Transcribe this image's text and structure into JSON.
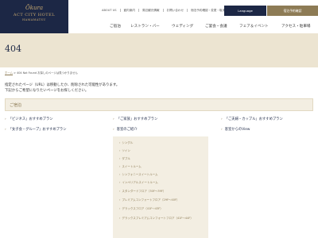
{
  "header": {
    "logo": {
      "mark": "Ōkura",
      "line1": "ACT CITY HOTEL",
      "line2": "HAMAMATSU"
    },
    "utility_links": [
      "ABOUT US",
      "館内案内",
      "周辺観光情報",
      "お問い合わせ",
      "宿泊予約確認・変更・取消"
    ],
    "language_label": "Language",
    "reserve_label": "宿泊予約確認",
    "nav": [
      "ご宿泊",
      "レストラン・バー",
      "ウェディング",
      "ご宴会・会議",
      "フェア＆イベント",
      "アクセス・駐車場"
    ]
  },
  "page": {
    "title": "404",
    "breadcrumb_home": "ホーム",
    "breadcrumb_current": "404 Not Found お探しのページは見つかりません",
    "message_line1": "指定されたページ（URL）は移動したか、削除された可能性があります。",
    "message_line2": "下記からご希望になりたいページをお探しください。"
  },
  "section": {
    "title": "ご宿泊"
  },
  "links": [
    "「ビジネス」おすすめプラン",
    "「ご家族」おすすめプラン",
    "「ご夫婦・カップル」おすすめプラン",
    "「女子会・グループ」おすすめプラン",
    "客室のご紹介",
    "客室からのView"
  ],
  "submenu": [
    "シングル",
    "ツイン",
    "ダブル",
    "スイートルーム",
    "シンフォニースイートルーム",
    "インペリアルスイートルーム",
    "スタンダードフロア（30F～39F）",
    "プレミアムコンフォートフロア（29F～40F）",
    "デラックスフロア（41F～43F）",
    "デラックスプレミアムコンフォートフロア（41F～44F）"
  ]
}
